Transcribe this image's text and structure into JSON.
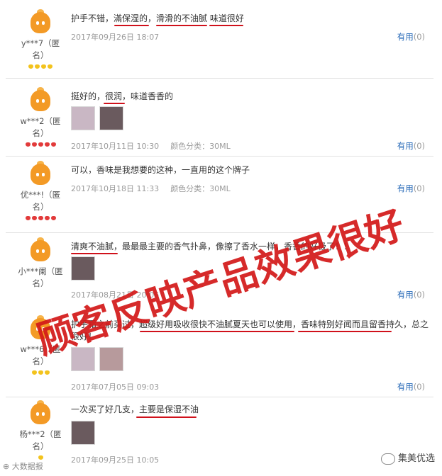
{
  "reviews": [
    {
      "user": "y***7（匿名）",
      "text": "护手不错，滿保湿的，滑滑的不油腻 味道很好",
      "date": "2017年09月26日 18:07",
      "spec": "",
      "helpful_label": "有用",
      "helpful_count": "(0)"
    },
    {
      "user": "w***2（匿名）",
      "text": "挺好的，很润，味道香香的",
      "date": "2017年10月11日 10:30",
      "spec": "颜色分类：30ML",
      "helpful_label": "有用",
      "helpful_count": "(0)"
    },
    {
      "user": "优***!（匿名）",
      "text": "可以，香味是我想要的这种，一直用的这个牌子",
      "date": "2017年10月18日 11:33",
      "spec": "颜色分类：30ML",
      "helpful_label": "有用",
      "helpful_count": "(0)"
    },
    {
      "user": "小***阑（匿名）",
      "text": "清爽不油腻，最最最主要的香气扑鼻，像擦了香水一样，香香的好极了！！",
      "date": "2017年08月21日 20:06",
      "spec": "",
      "helpful_label": "有用",
      "helpful_count": "(0)"
    },
    {
      "user": "w***6（匿名）",
      "text": "护手霜之前买过，超级好用吸收很快不油腻夏天也可以使用，香味特别好闻而且留香持久，总之很好！",
      "date": "2017年07月05日 09:03",
      "spec": "",
      "helpful_label": "有用",
      "helpful_count": "(0)"
    },
    {
      "user": "杨***2（匿名）",
      "text": "一次买了好几支，主要是保湿不油",
      "date": "2017年09月25日 10:05",
      "spec": "",
      "helpful_label": "有用",
      "helpful_count": "(0)"
    }
  ],
  "overlay_text": "顾客反映产品效果很好",
  "watermark": "大数据报",
  "brand": "集美优选",
  "colors": {
    "annotation": "#d31a1a",
    "link": "#2a6bb8"
  }
}
